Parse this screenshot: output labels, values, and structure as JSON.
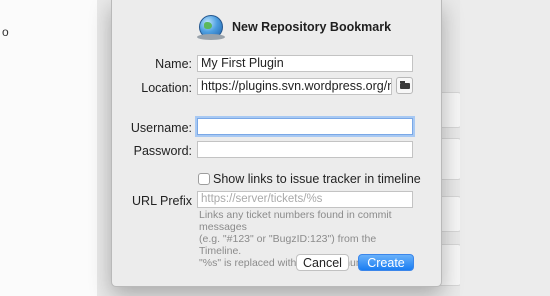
{
  "background": {
    "sidebar_text": "o"
  },
  "dialog": {
    "title": "New Repository Bookmark",
    "name_label": "Name:",
    "name_value": "My First Plugin",
    "location_label": "Location:",
    "location_value": "https://plugins.svn.wordpress.org/my-first",
    "username_label": "Username:",
    "username_value": "",
    "password_label": "Password:",
    "password_value": "",
    "checkbox_label": "Show links to issue tracker in timeline",
    "checkbox_checked": false,
    "url_prefix_label": "URL Prefix",
    "url_prefix_placeholder": "https://server/tickets/%s",
    "help_lines": [
      "Links any ticket numbers found in commit messages",
      "(e.g. \"#123\" or \"BugzID:123\") from the Timeline.",
      "\"%s\" is replaced with the ticket number."
    ],
    "cancel_label": "Cancel",
    "create_label": "Create"
  },
  "colors": {
    "primary_button": "#1a7df2",
    "focus_ring": "#a8c9f3"
  },
  "icons": {
    "title_icon": "globe-icon",
    "browse_icon": "folder-icon"
  }
}
